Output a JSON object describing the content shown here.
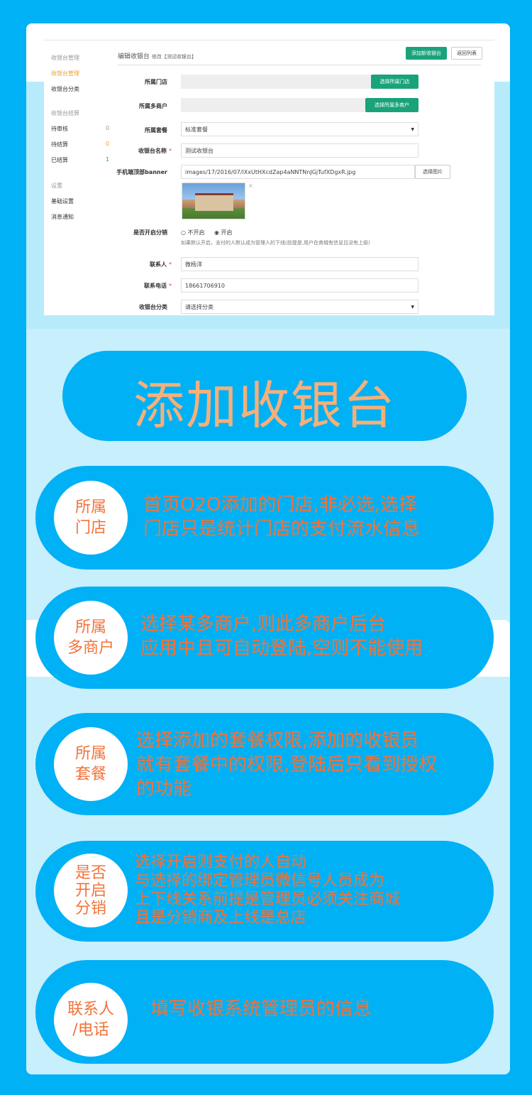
{
  "screenshot": {
    "sidebar": {
      "group1": "收银台管理",
      "manage": "收银台管理",
      "category": "收银台分类",
      "group2": "收银台结算",
      "pending_review": "待审核",
      "pending_review_count": "0",
      "pending_settle": "待结算",
      "pending_settle_count": "0",
      "settled": "已结算",
      "settled_count": "1",
      "group3": "设置",
      "basic": "基础设置",
      "notify": "消息通知"
    },
    "header": {
      "title": "编辑收银台",
      "sub": "修改【测试收银台】",
      "add_button": "添加新收银台",
      "back_button": "返回列表"
    },
    "form": {
      "store_label": "所属门店",
      "store_button": "选择所属门店",
      "merchant_label": "所属多商户",
      "merchant_button": "选择所属多商户",
      "package_label": "所属套餐",
      "package_value": "标准套餐",
      "name_label": "收银台名称",
      "name_value": "测试收银台",
      "banner_label": "手机端顶部banner",
      "banner_value": "images/17/2016/07/lXxUtHXcdZap4aNNTNnJGjTufXDgxR.jpg",
      "banner_button": "选择图片",
      "thumb_close": "×",
      "distrib_label": "是否开启分销",
      "distrib_off": "不开启",
      "distrib_on": "开启",
      "distrib_hint": "如果默认开启，支付的人默认成为管理人的下线(前提是,用户在商城有信息且没有上级)",
      "contact_label": "联系人",
      "contact_value": "微杨洋",
      "phone_label": "联系电话",
      "phone_value": "18661706910",
      "cat_label": "收银台分类",
      "cat_value": "请选择分类",
      "required_mark": "*"
    }
  },
  "title": "添加收银台",
  "cards": [
    {
      "tag": "所属\n门店",
      "text": "首页O2O添加的门店,非必选,选择\n门店只是统计门店的支付流水信息"
    },
    {
      "tag": "所属\n多商户",
      "text": "选择某多商户,则此多商户后台\n应用中且可自动登陆,空则不能使用"
    },
    {
      "tag": "所属\n套餐",
      "text": "选择添加的套餐权限,添加的收银员\n就有套餐中的权限,登陆后只看到授权\n的功能"
    },
    {
      "tag": "是否\n开启\n分销",
      "text": "选择开启则支付的人自动\n与选择的绑定管理员微信号人员成为\n上下线关系前提是管理员必须关注商城\n且是分销商及上线是总店"
    },
    {
      "tag": "联系人\n/电话",
      "text": "填写收银系统管理员的信息"
    }
  ],
  "colors": {
    "background": "#00b1f5",
    "accent": "#f2733a",
    "title": "#f5b07a",
    "green_button": "#1aa37a"
  }
}
